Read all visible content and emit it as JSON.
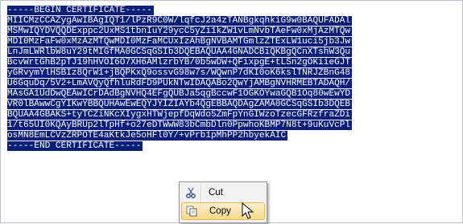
{
  "certificate": {
    "lines": [
      "-----BEGIN CERTIFICATE-----",
      "MIICMzCCAZygAwIBAgIQT1/lPzR9C0W/lqfcJ2a4zTANBgkqhkiG9w0BAQUFADAl",
      "MSMwIQYDVQQDExppc2UxMS1tbnIuY29ycC5yZi1kZW1vLmNvbTAeFw0xMjAzMTQw",
      "MDI0MzFaFw0xMzAzMTQwMDI0MzFaMCUxIzAhBgNVBAMTGmlzZTExLW1uci5jb3Jw",
      "LnJmLWRlbW8uY29tMIGfMA0GCSqGSIb3DQEBAQUAA4GNADCBiQKBgQCnXTshW3Qu",
      "BcvWrtGhB2pTJ19hHVOI6O7XH6AMlzrbYB/0b5wDW+QFixpgE+tLSn2gOKiieGJT",
      "yGRvymYlHSBIz8QrW1+jBQPKxQ9ossvG98w7s/WQwnP7dKI0oK6kslTNRJZBnG48",
      "U6GquDq/5V2+LmAVQyQfhluRdFD9PUkNTwIDAQABo2QwYjAMBgNVHRMEBTADAQH/",
      "MAsGA1UdDwQEAwICrDAdBgNVHQ4EFgQUBJa5qgBccwF1OGKOYwaGQB1Oq80wEwYD",
      "VR0lBAwwCgYIKwYBBQUHAwEwEQYJYIZIAYb4QgEBBAQDAgZAMA0GCSqGSIb3DQEB",
      "BQUAA4GBAKS+tyTCZiNKcXIygxHTWjepfDqWdo5ZmFpYnGIWzoTzecGFRzfraZDi",
      "1/t65UI0KQAyBRUp2lTpHf+o27eDTWwW83bCmbDln0PpwhoKBMP7N8t+9uKuVcPl",
      "osMN8EmLCVzZRPOTE4aKtkJe5oHFl0Y/+vPrb1pMhPP2hbyekAIC",
      "-----END CERTIFICATE-----"
    ]
  },
  "context_menu": {
    "cut_label": "Cut",
    "copy_label": "Copy",
    "cut_icon": "scissors-icon",
    "copy_icon": "copy-icon"
  },
  "colors": {
    "selection_bg": "#0b1e78",
    "selection_fg": "#ffffff",
    "menu_hover": "#f8d98a"
  }
}
